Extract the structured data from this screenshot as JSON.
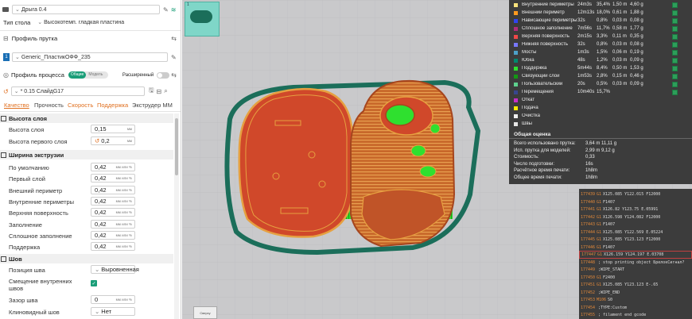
{
  "printer": {
    "name": "Дрыга 0.4"
  },
  "bed": {
    "label": "Тип стола",
    "value": "Высокотемп. гладкая пластина"
  },
  "filament": {
    "section": "Профиль прутка",
    "index": "1",
    "name": "Generic_ПластикОФФ_235"
  },
  "process": {
    "section": "Профиль процесса",
    "toggle_on": "Общие",
    "toggle_off": "Модель",
    "advanced": "Расширенный",
    "preset": "* 0.15 СлайдG17"
  },
  "tabs": [
    "Качество",
    "Прочность",
    "Скорость",
    "Поддержка",
    "Экструдер ММ"
  ],
  "groups": {
    "layer_height": {
      "title": "Высота слоя",
      "rows": [
        {
          "label": "Высота слоя",
          "value": "0,15",
          "unit": "мм"
        },
        {
          "label": "Высота первого слоя",
          "value": "0,2",
          "unit": "мм"
        }
      ]
    },
    "line_width": {
      "title": "Ширина экструзии",
      "rows": [
        {
          "label": "По умолчанию",
          "value": "0,42",
          "unit": "мм или %"
        },
        {
          "label": "Первый слой",
          "value": "0,42",
          "unit": "мм или %"
        },
        {
          "label": "Внешний периметр",
          "value": "0,42",
          "unit": "мм или %"
        },
        {
          "label": "Внутренние периметры",
          "value": "0,42",
          "unit": "мм или %"
        },
        {
          "label": "Верхняя поверхность",
          "value": "0,42",
          "unit": "мм или %"
        },
        {
          "label": "Заполнение",
          "value": "0,42",
          "unit": "мм или %"
        },
        {
          "label": "Сплошное заполнение",
          "value": "0,42",
          "unit": "мм или %"
        },
        {
          "label": "Поддержка",
          "value": "0,42",
          "unit": "мм или %"
        }
      ]
    },
    "seam": {
      "title": "Шов",
      "position_label": "Позиция шва",
      "position_value": "Выровненная",
      "stagger_label_1": "Смещение внутренних",
      "stagger_label_2": "швов",
      "gap_label": "Зазор шва",
      "gap_value": "0",
      "gap_unit": "мм или %",
      "wipe_label": "Клиновидный шов",
      "wipe_value": "Нет"
    }
  },
  "legend": {
    "rows": [
      {
        "name": "Внутренние периметры",
        "time": "24m3s",
        "pct": "35,4%",
        "len": "1,50 m",
        "w": "4,60 g",
        "color": "#f7e27c"
      },
      {
        "name": "Внешний периметр",
        "time": "12m13s",
        "pct": "18,0%",
        "len": "0,61 m",
        "w": "1,88 g",
        "color": "#ff9a1f"
      },
      {
        "name": "Нависающие периметры",
        "time": "32s",
        "pct": "0,8%",
        "len": "0,03 m",
        "w": "0,08 g",
        "color": "#2f44f0"
      },
      {
        "name": "Сплошное заполнение",
        "time": "7m56s",
        "pct": "11,7%",
        "len": "0,58 m",
        "w": "1,77 g",
        "color": "#b02c7a"
      },
      {
        "name": "Верхняя поверхность",
        "time": "2m15s",
        "pct": "3,3%",
        "len": "0,11 m",
        "w": "0,35 g",
        "color": "#f04848"
      },
      {
        "name": "Нижняя поверхность",
        "time": "32s",
        "pct": "0,8%",
        "len": "0,03 m",
        "w": "0,08 g",
        "color": "#7878ff"
      },
      {
        "name": "Мосты",
        "time": "1m3s",
        "pct": "1,5%",
        "len": "0,06 m",
        "w": "0,19 g",
        "color": "#4da0c8"
      },
      {
        "name": "Юбка",
        "time": "48s",
        "pct": "1,2%",
        "len": "0,03 m",
        "w": "0,09 g",
        "color": "#00876e"
      },
      {
        "name": "Поддержка",
        "time": "5m44s",
        "pct": "8,4%",
        "len": "0,50 m",
        "w": "1,53 g",
        "color": "#2fe02f"
      },
      {
        "name": "Связующий слой",
        "time": "1m53s",
        "pct": "2,8%",
        "len": "0,15 m",
        "w": "0,46 g",
        "color": "#139813"
      },
      {
        "name": "Пользовательский",
        "time": "20s",
        "pct": "0,5%",
        "len": "0,03 m",
        "w": "0,09 g",
        "color": "#5ed18e"
      },
      {
        "name": "Перемещения",
        "time": "10m40s",
        "pct": "15,7%",
        "len": "",
        "w": "",
        "color": "#38468e"
      },
      {
        "name": "Откат",
        "time": "",
        "pct": "",
        "len": "",
        "w": "",
        "color": "#c82ec8"
      },
      {
        "name": "Подача",
        "time": "",
        "pct": "",
        "len": "",
        "w": "",
        "color": "#ffeb00"
      },
      {
        "name": "Очистка",
        "time": "",
        "pct": "",
        "len": "",
        "w": "",
        "color": "#f0f0f0"
      },
      {
        "name": "Швы",
        "time": "",
        "pct": "",
        "len": "",
        "w": "",
        "color": "#e6e6e6"
      }
    ],
    "summary_title": "Общая оценка",
    "summary": [
      {
        "k": "Всего использовано прутка:",
        "v": "3,64 m     11,11 g"
      },
      {
        "k": "Исп. прутка для моделей:",
        "v": "2,99 m     9,12 g"
      },
      {
        "k": "Стоимость:",
        "v": "0,33"
      },
      {
        "k": "Число подготовки:",
        "v": "16s"
      },
      {
        "k": "Расчётное время печати:",
        "v": "1h8m"
      },
      {
        "k": "Общее время печати:",
        "v": "1h8m"
      }
    ]
  },
  "gcode": [
    {
      "n": "177439",
      "c1": "G1",
      "c2": "X125.085 Y122.015 F12000"
    },
    {
      "n": "177440",
      "c1": "G1",
      "c2": "F1407"
    },
    {
      "n": "177441",
      "c1": "G1",
      "c2": "X126.82 Y123.75 E.05991"
    },
    {
      "n": "177442",
      "c1": "G1",
      "c2": "X126.598 Y124.082 F12000"
    },
    {
      "n": "177443",
      "c1": "G1",
      "c2": "F1407"
    },
    {
      "n": "177444",
      "c1": "G1",
      "c2": "X125.085 Y122.569 E.05224"
    },
    {
      "n": "177445",
      "c1": "G1",
      "c2": "X125.085 Y123.123 F12000"
    },
    {
      "n": "177446",
      "c1": "G1",
      "c2": "F1407"
    },
    {
      "n": "177447",
      "c1": "G1",
      "c2": "X126.159 Y124.197 E.03708"
    },
    {
      "n": "177448",
      "c1": "",
      "c2": "; stop printing object БрелокСигнал?"
    },
    {
      "n": "177449",
      "c1": "",
      "c2": ";WIPE_START"
    },
    {
      "n": "177450",
      "c1": "G1",
      "c2": "F2400"
    },
    {
      "n": "177451",
      "c1": "G1",
      "c2": "X125.085 Y123.123 E-.65"
    },
    {
      "n": "177452",
      "c1": "",
      "c2": ";WIPE_END"
    },
    {
      "n": "177453",
      "c1": "M106",
      "c2": "S0"
    },
    {
      "n": "177454",
      "c1": "",
      "c2": ";TYPE:Custom"
    },
    {
      "n": "177455",
      "c1": "",
      "c2": "; filament end gcode"
    }
  ],
  "view": {
    "thumb_index": "1",
    "button": "Сверху"
  },
  "colors": {
    "accent": "#e07020",
    "toggle": "#1a9e78",
    "perimeter": "#c85a2a",
    "support": "#2fe02f",
    "skirt": "#1b6e5a"
  }
}
